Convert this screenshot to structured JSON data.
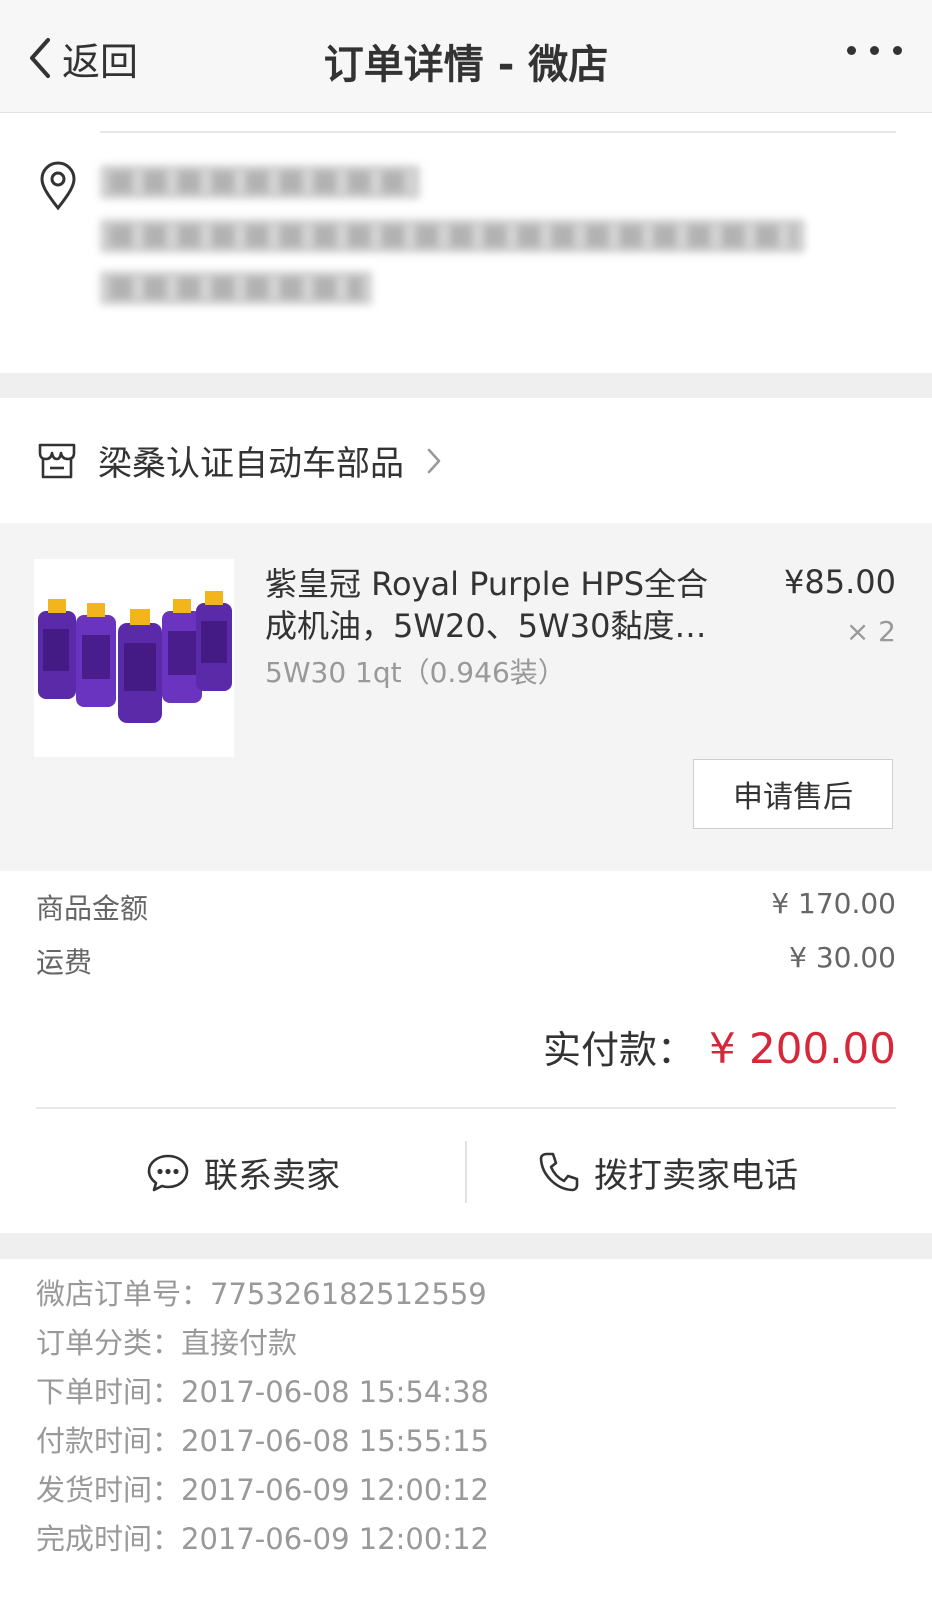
{
  "nav": {
    "back_label": "返回",
    "title": "订单详情 - 微店"
  },
  "shop": {
    "name": "梁桑认证自动车部品"
  },
  "product": {
    "title": "紫皇冠 Royal Purple HPS全合成机油，5W20、5W30黏度…",
    "variant": "5W30 1qt（0.946装）",
    "price": "¥85.00",
    "quantity": "× 2",
    "aftersale_label": "申请售后"
  },
  "summary": {
    "goods_label": "商品金额",
    "goods_value": "¥ 170.00",
    "shipping_label": "运费",
    "shipping_value": "¥ 30.00",
    "paid_label": "实付款：",
    "paid_value": "¥ 200.00"
  },
  "contact": {
    "chat_label": "联系卖家",
    "call_label": "拨打卖家电话"
  },
  "details": [
    {
      "text": "微店订单号：775326182512559"
    },
    {
      "text": "订单分类：直接付款"
    },
    {
      "text": "下单时间：2017-06-08 15:54:38"
    },
    {
      "text": "付款时间：2017-06-08 15:55:15"
    },
    {
      "text": "发货时间：2017-06-09 12:00:12"
    },
    {
      "text": "完成时间：2017-06-09 12:00:12"
    }
  ],
  "colors": {
    "accent_red": "#d6283a",
    "product_purple": "#5b2aa8",
    "cap_yellow": "#f2b61c"
  },
  "icons": [
    "chevron-left-icon",
    "more-icon",
    "location-pin-icon",
    "shop-icon",
    "chevron-right-icon",
    "chat-icon",
    "phone-icon"
  ]
}
